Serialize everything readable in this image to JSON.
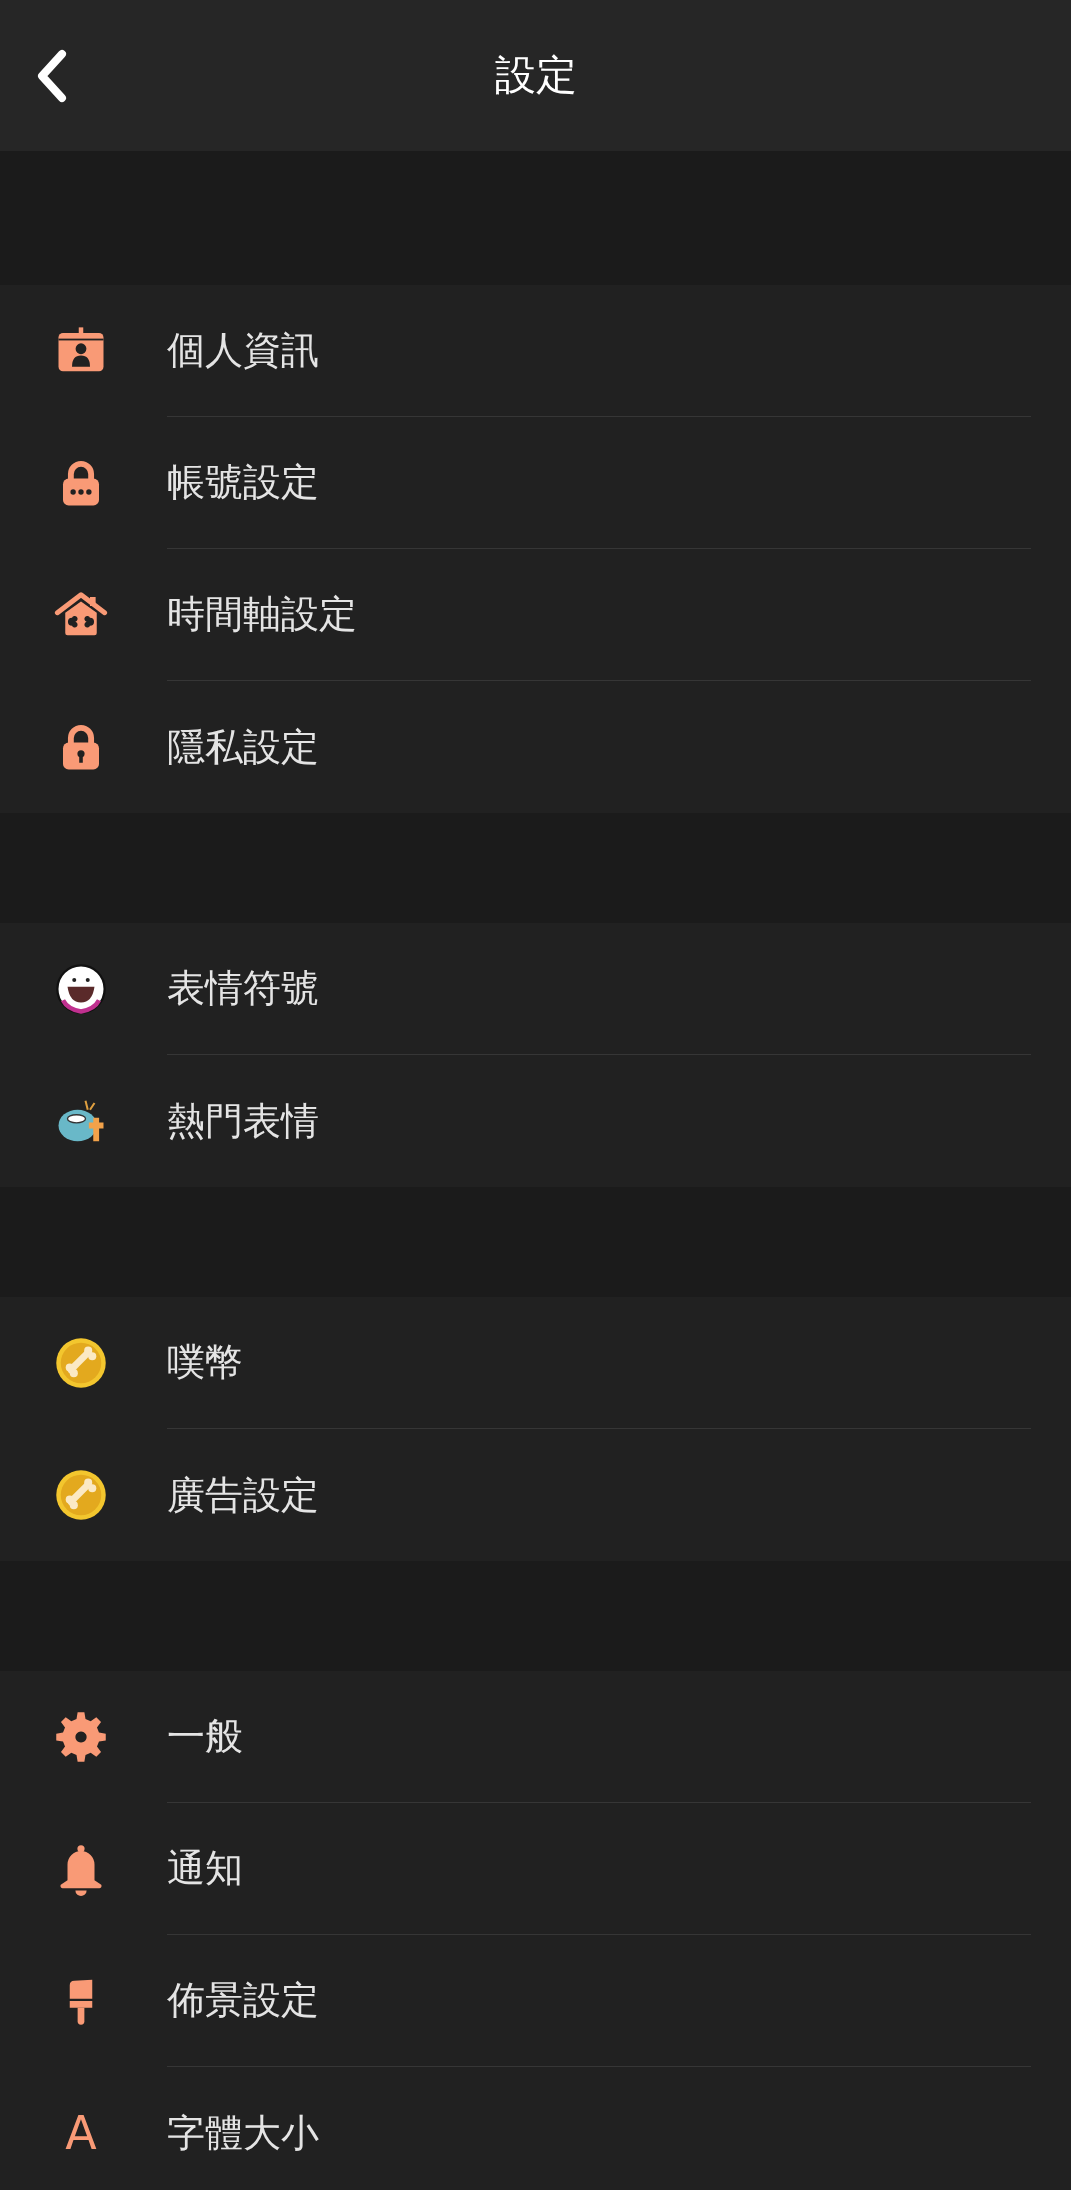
{
  "header": {
    "title": "設定"
  },
  "sections": [
    {
      "items": [
        {
          "label": "個人資訊"
        },
        {
          "label": "帳號設定"
        },
        {
          "label": "時間軸設定"
        },
        {
          "label": "隱私設定"
        }
      ]
    },
    {
      "items": [
        {
          "label": "表情符號"
        },
        {
          "label": "熱門表情"
        }
      ]
    },
    {
      "items": [
        {
          "label": "噗幣"
        },
        {
          "label": "廣告設定"
        }
      ]
    },
    {
      "items": [
        {
          "label": "一般"
        },
        {
          "label": "通知"
        },
        {
          "label": "佈景設定"
        },
        {
          "label": "字體大小",
          "icon_text": "A"
        }
      ]
    }
  ]
}
